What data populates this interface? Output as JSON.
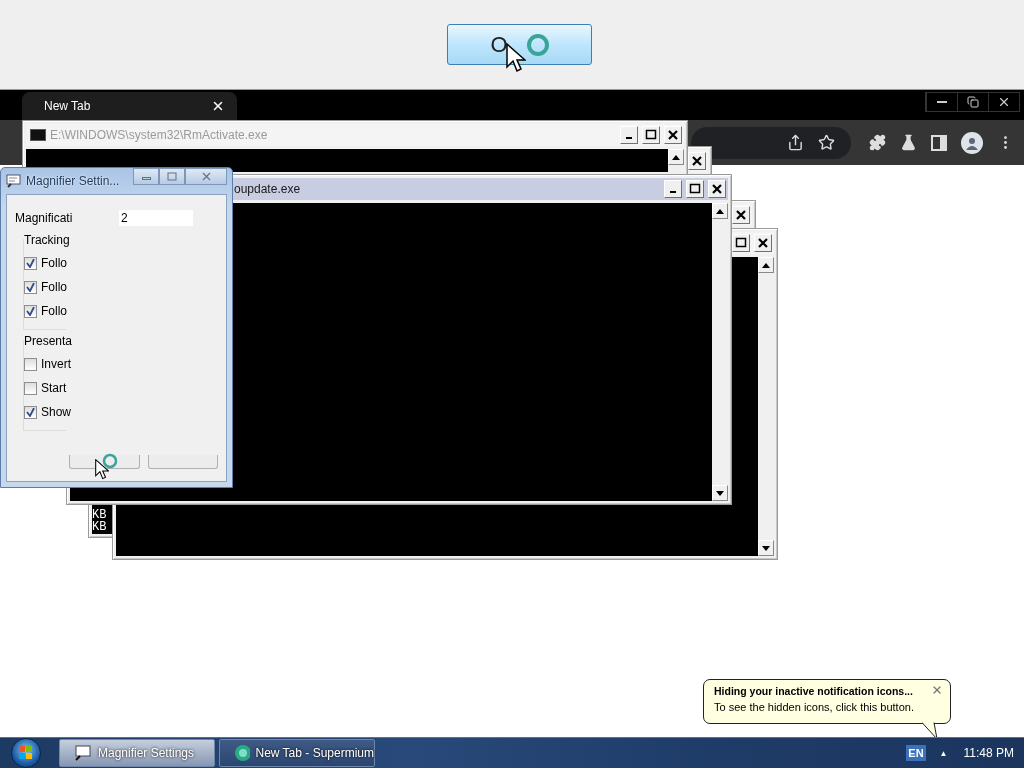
{
  "lens_button": {
    "label": "O"
  },
  "browser": {
    "tab": {
      "title": "New Tab"
    }
  },
  "console_windows": [
    {
      "title": "E:\\WINDOWS\\system32\\RmActivate.exe",
      "active": false
    },
    {
      "title": "oupdate.exe",
      "active": true
    },
    {
      "lines": [
        "KB",
        "KB"
      ]
    }
  ],
  "magnifier_settings": {
    "title": "Magnifier Settin...",
    "magnification": {
      "label": "Magnificati",
      "value": "2"
    },
    "groups": [
      {
        "label": "Tracking",
        "options": [
          {
            "label": "Follo",
            "checked": true
          },
          {
            "label": "Follo",
            "checked": true
          },
          {
            "label": "Follo",
            "checked": true
          }
        ]
      },
      {
        "label": "Presenta",
        "options": [
          {
            "label": "Invert",
            "checked": false
          },
          {
            "label": "Start",
            "checked": false
          },
          {
            "label": "Show",
            "checked": true
          }
        ]
      }
    ]
  },
  "balloon": {
    "title": "Hiding your inactive notification icons...",
    "text": "To see the hidden icons, click this button."
  },
  "taskbar": {
    "buttons": [
      {
        "label": "Magnifier Settings",
        "selected": true
      },
      {
        "label": "New Tab - Supermium",
        "selected": false
      }
    ],
    "language": "EN",
    "tray_arrow": "▲",
    "clock": "11:48 PM"
  }
}
